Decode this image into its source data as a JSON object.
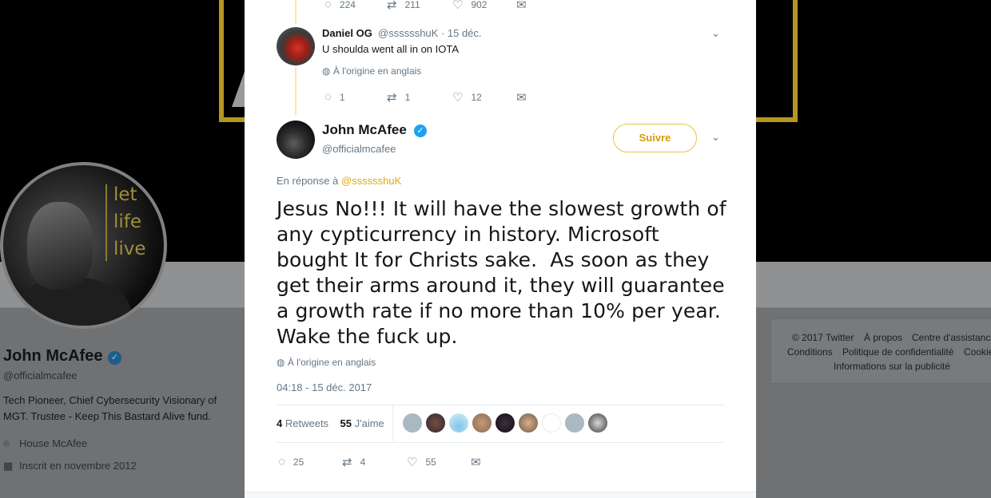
{
  "background_profile": {
    "avatar_text": [
      "let",
      "life",
      "live"
    ],
    "name": "John McAfee",
    "handle": "@officialmcafee",
    "bio": "Tech Pioneer, Chief Cybersecurity Visionary of MGT. Trustee - Keep This Bastard Alive fund.",
    "location": "House McAfee",
    "joined": "Inscrit en novembre 2012",
    "footer": {
      "copyright": "© 2017 Twitter",
      "about": "À propos",
      "help": "Centre d'assistance",
      "terms": "Conditions",
      "privacy": "Politique de confidentialité",
      "cookies": "Cookies",
      "ads": "Informations sur la publicité"
    }
  },
  "previous_tweet_actions": {
    "replies": "224",
    "retweets": "211",
    "likes": "902"
  },
  "reply_tweet": {
    "name": "Daniel OG",
    "meta": "@sssssshuK · 15 déc.",
    "text": "U shoulda went all in on IOTA",
    "translate": "À l'origine en anglais",
    "replies": "1",
    "retweets": "1",
    "likes": "12"
  },
  "main_tweet": {
    "name": "John McAfee",
    "handle": "@officialmcafee",
    "follow_label": "Suivre",
    "reply_prefix": "En réponse à",
    "reply_mention": "@sssssshuK",
    "text": "Jesus No!!! It will have the slowest growth of any cypticurrency in history. Microsoft bought It for Christs sake.  As soon as they get their arms around it, they will guarantee a growth rate if no more than 10% per year. Wake the fuck up.",
    "translate": "À l'origine en anglais",
    "timestamp": "04:18 - 15 déc. 2017",
    "retweets_count": "4",
    "retweets_label": "Retweets",
    "likes_count": "55",
    "likes_label": "J'aime",
    "replies": "25",
    "retweets": "4",
    "likes": "55"
  },
  "colors": {
    "accent": "#e0a910",
    "muted": "#657786",
    "thread_line": "#fbe99b",
    "verified": "#1da1f2"
  },
  "icons": {
    "reply": "reply-icon",
    "retweet": "retweet-icon",
    "like": "heart-icon",
    "message": "envelope-icon",
    "caret": "chevron-down-icon",
    "globe": "globe-icon",
    "verified": "verified-badge-icon"
  }
}
